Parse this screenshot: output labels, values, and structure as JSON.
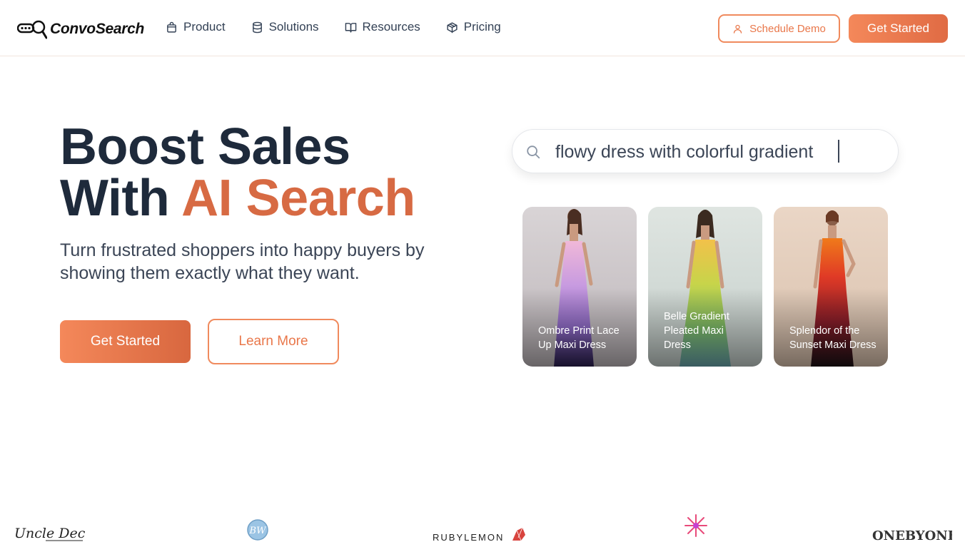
{
  "header": {
    "logo_text": "ConvoSearch",
    "nav": [
      {
        "label": "Product",
        "icon": "shopping-bag-icon"
      },
      {
        "label": "Solutions",
        "icon": "database-icon"
      },
      {
        "label": "Resources",
        "icon": "book-open-icon"
      },
      {
        "label": "Pricing",
        "icon": "package-icon"
      }
    ],
    "schedule_demo_label": "Schedule Demo",
    "get_started_label": "Get Started"
  },
  "hero": {
    "title_line1": "Boost Sales",
    "title_line2_plain": "With ",
    "title_line2_accent": "AI Search",
    "subtitle": "Turn frustrated shoppers into happy buyers by showing them exactly what they want.",
    "get_started_label": "Get Started",
    "learn_more_label": "Learn More"
  },
  "search": {
    "value": "flowy dress with colorful gradient"
  },
  "results": [
    {
      "label": "Ombre Print Lace Up Maxi Dress"
    },
    {
      "label": "Belle Gradient Pleated Maxi Dress"
    },
    {
      "label": "Splendor of the Sunset Maxi Dress"
    }
  ],
  "brand_logos": {
    "uncle_deco": "Uncle Deco",
    "bw": "BW",
    "ruby_lemon": "RUBYLEMON",
    "onebyone": "ONEBYONE"
  },
  "colors": {
    "accent": "#d76a43",
    "button_gradient_start": "#f4885a",
    "button_gradient_end": "#e06b44",
    "heading": "#1e2a3b"
  }
}
